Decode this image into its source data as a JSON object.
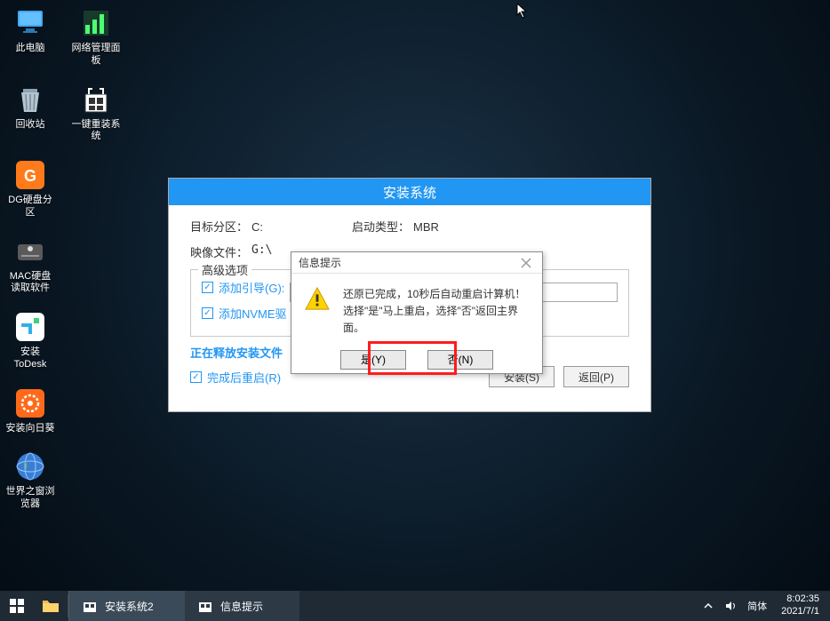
{
  "desktop": {
    "icons": [
      {
        "name": "this-pc",
        "label": "此电脑"
      },
      {
        "name": "network-panel",
        "label": "网络管理面板"
      },
      {
        "name": "recycle-bin",
        "label": "回收站"
      },
      {
        "name": "reinstall-system",
        "label": "一键重装系统"
      },
      {
        "name": "dg-disk",
        "label": "DG硬盘分区"
      },
      {
        "name": "mac-disk-reader",
        "label": "MAC硬盘读取软件"
      },
      {
        "name": "install-todesk",
        "label": "安装ToDesk"
      },
      {
        "name": "install-sunflower",
        "label": "安装向日葵"
      },
      {
        "name": "world-window-browser",
        "label": "世界之窗浏览器"
      }
    ]
  },
  "installer": {
    "title": "安装系统",
    "target_label": "目标分区：",
    "target_value": "C:",
    "boot_label": "启动类型：",
    "boot_value": "MBR",
    "image_label": "映像文件：",
    "image_value": "G:\\",
    "advanced_legend": "高级选项",
    "chk_boot": "添加引导(G):",
    "chk_nvme": "添加NVME驱",
    "progress": "正在释放安装文件",
    "chk_restart": "完成后重启(R)",
    "btn_install": "安装(S)",
    "btn_back": "返回(P)"
  },
  "dialog": {
    "title": "信息提示",
    "line1": "还原已完成，10秒后自动重启计算机！",
    "line2": "选择\"是\"马上重启，选择\"否\"返回主界面。",
    "btn_yes": "是(Y)",
    "btn_no": "否(N)"
  },
  "taskbar": {
    "items": [
      {
        "label": "安装系统2"
      },
      {
        "label": "信息提示"
      }
    ],
    "ime": "简体",
    "time": "8:02:35",
    "date": "2021/7/1"
  }
}
